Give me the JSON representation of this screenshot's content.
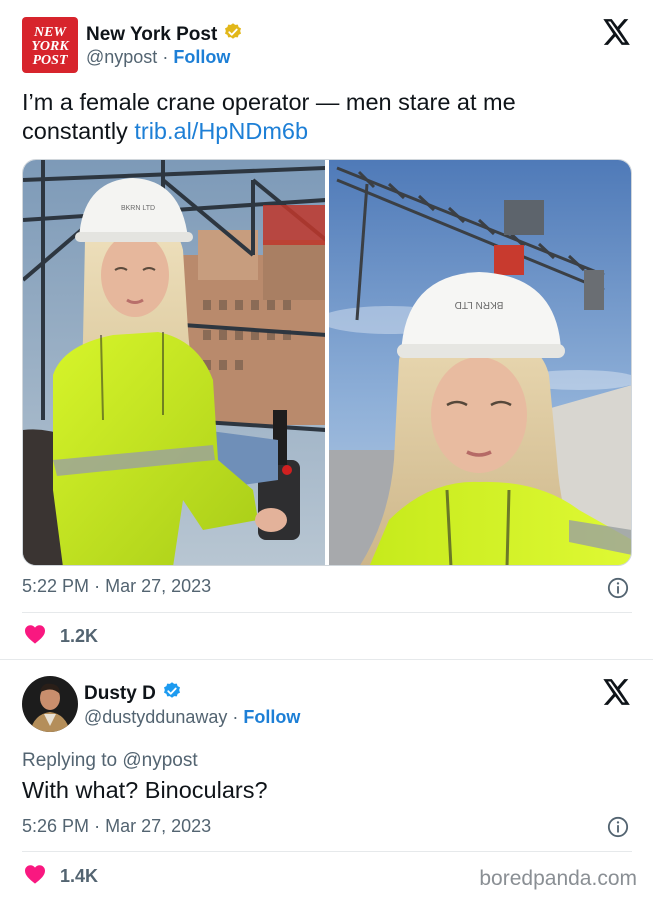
{
  "tweet1": {
    "author_name": "New York Post",
    "logo_text": [
      "NEW",
      "YORK",
      "POST"
    ],
    "handle": "@nypost",
    "separator": "·",
    "follow_label": "Follow",
    "text": "I’m a female crane operator — men stare at me constantly",
    "link": "trib.al/HpNDm6b",
    "time": "5:22 PM",
    "date": "Mar 27, 2023",
    "likes": "1.2K",
    "helmet_text": "BKRN LTD"
  },
  "tweet2": {
    "author_name": "Dusty D",
    "handle": "@dustyddunaway",
    "separator": "·",
    "follow_label": "Follow",
    "replying_to": "Replying to @nypost",
    "text": "With what? Binoculars?",
    "time": "5:26 PM",
    "date": "Mar 27, 2023",
    "likes": "1.4K"
  },
  "watermark": "boredpanda.com",
  "colors": {
    "link": "#1d7fd6",
    "heart": "#f91880",
    "verified_gold": "#e2b719",
    "verified_blue": "#1d9bf0",
    "nypost_red": "#d7242c"
  },
  "icons": [
    "verified-gold-icon",
    "verified-blue-icon",
    "x-logo-icon",
    "info-icon",
    "heart-icon"
  ]
}
